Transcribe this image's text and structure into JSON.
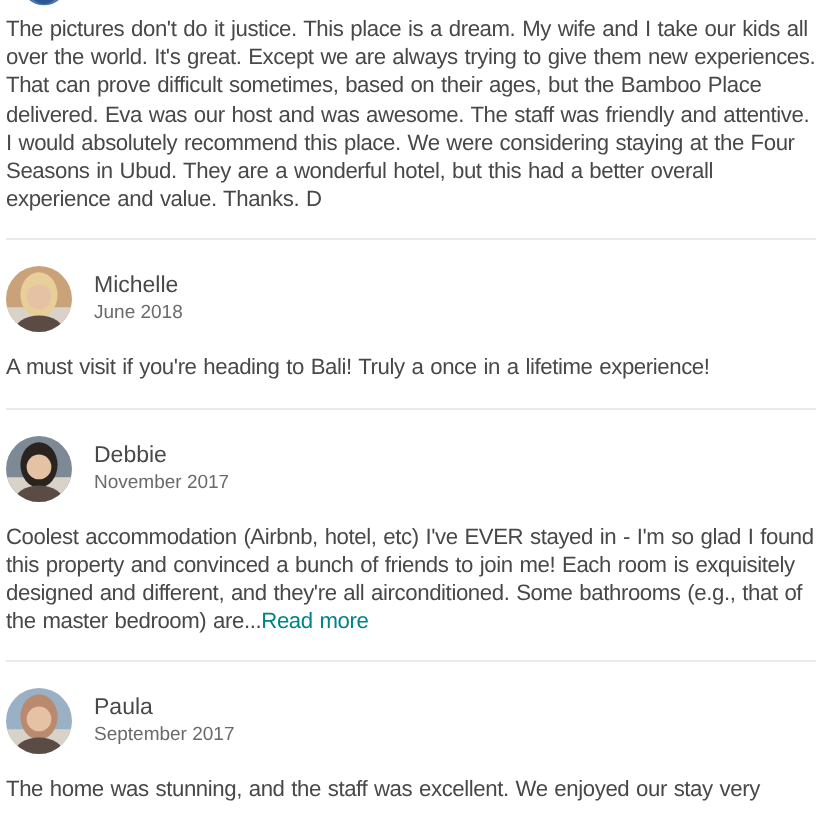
{
  "reviews": [
    {
      "text": "The pictures don't do it justice. This place is a dream. My wife and I take our kids all over the world. It's great. Except we are always trying to give them new experiences. That can prove difficult sometimes, based on their ages, but the Bamboo Place delivered. Eva was our host and was awesome. The staff was friendly and attentive. I would absolutely recommend this place. We were considering staying at the Four Seasons in Ubud. They are a wonderful hotel, but this had a better overall experience and value. Thanks. D"
    },
    {
      "name": "Michelle",
      "date": "June 2018",
      "text": "A must visit if you're heading to Bali! Truly a once in a lifetime experience!"
    },
    {
      "name": "Debbie",
      "date": "November 2017",
      "text": "Coolest accommodation (Airbnb, hotel, etc) I've EVER stayed in - I'm so glad I found this property and convinced a bunch of friends to join me! Each room is exquisitely designed and different, and they're all airconditioned. Some bathrooms (e.g., that of the master bedroom) are...",
      "link": "Read more"
    },
    {
      "name": "Paula",
      "date": "September 2017",
      "text": "The home was stunning, and the staff was excellent. We enjoyed our stay very"
    }
  ]
}
